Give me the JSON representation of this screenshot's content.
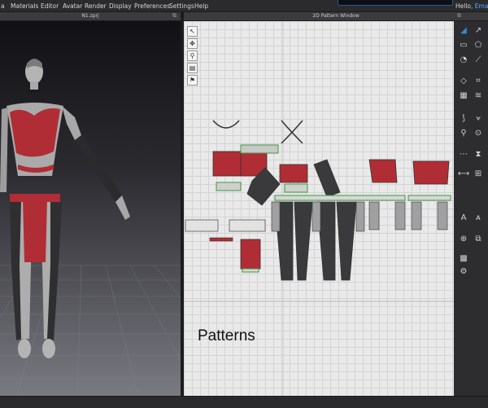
{
  "menu": {
    "items": [
      "a",
      "Materials",
      "Editor",
      "Avatar",
      "Render",
      "Display",
      "Preferences",
      "Settings",
      "Help"
    ],
    "greeting_prefix": "Hello,",
    "user_name": "EmadAb"
  },
  "viewport3d": {
    "title": "N1.zprj"
  },
  "pattern_window": {
    "title": "2D Pattern Window",
    "label": "Patterns"
  },
  "colors": {
    "garment_red": "#b12d35",
    "garment_dark": "#3a3a3c",
    "skin_grey": "#b0b0b0",
    "seam_green": "#3c9a3c",
    "accent_blue": "#2f8fe0"
  },
  "tools2d": [
    "select-tool-icon",
    "transform-tool-icon",
    "zoom-tool-icon",
    "sewing-tool-icon",
    "pin-tool-icon"
  ],
  "toolbar_icons": [
    "select-icon",
    "edit-pattern-icon",
    "rectangle-icon",
    "polygon-icon",
    "circle-icon",
    "internal-line-icon",
    "dart-icon",
    "trace-icon",
    "fold-icon",
    "puckering-icon",
    "segment-sewing-icon",
    "free-sewing-icon",
    "pin-icon",
    "button-icon",
    "topstitch-icon",
    "zipper-icon",
    "measure-icon",
    "text-icon",
    "annotation-icon",
    "grade-icon",
    "avatar-icon",
    "arrange-icon",
    "fabric-icon",
    "trim-icon"
  ]
}
